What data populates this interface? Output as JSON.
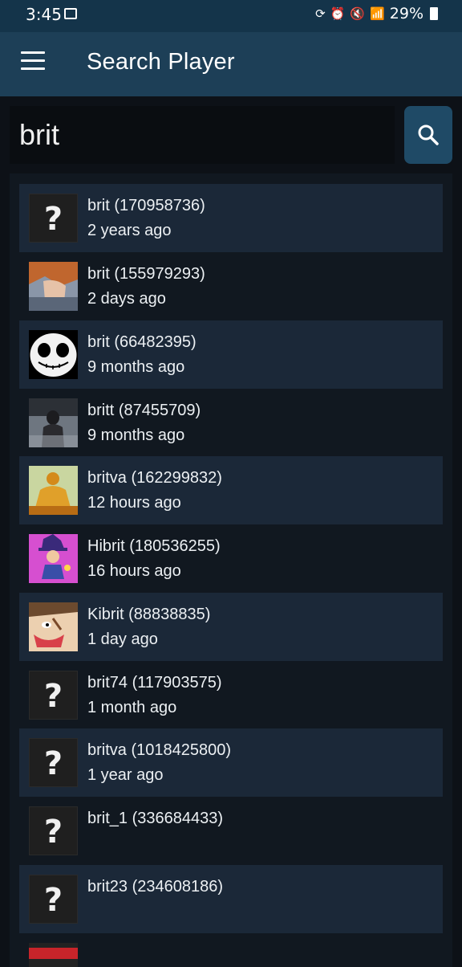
{
  "status": {
    "time": "3:45",
    "battery": "29%"
  },
  "appbar": {
    "title": "Search Player"
  },
  "search": {
    "value": "brit"
  },
  "results": [
    {
      "name": "brit (170958736)",
      "time": "2 years ago",
      "avatar": "unknown"
    },
    {
      "name": "brit (155979293)",
      "time": "2 days ago",
      "avatar": "anime-character"
    },
    {
      "name": "brit (66482395)",
      "time": "9 months ago",
      "avatar": "skull-face"
    },
    {
      "name": "britt (87455709)",
      "time": "9 months ago",
      "avatar": "crowd-photo"
    },
    {
      "name": "britva (162299832)",
      "time": "12 hours ago",
      "avatar": "golden-statue"
    },
    {
      "name": "Hibrit (180536255)",
      "time": "16 hours ago",
      "avatar": "hat-kid"
    },
    {
      "name": "Kibrit (88838835)",
      "time": "1 day ago",
      "avatar": "cartoon-face"
    },
    {
      "name": "brit74 (117903575)",
      "time": "1 month ago",
      "avatar": "unknown"
    },
    {
      "name": "britva (1018425800)",
      "time": "1 year ago",
      "avatar": "unknown"
    },
    {
      "name": "brit_1 (336684433)",
      "time": "",
      "avatar": "unknown"
    },
    {
      "name": "brit23 (234608186)",
      "time": "",
      "avatar": "unknown"
    }
  ]
}
